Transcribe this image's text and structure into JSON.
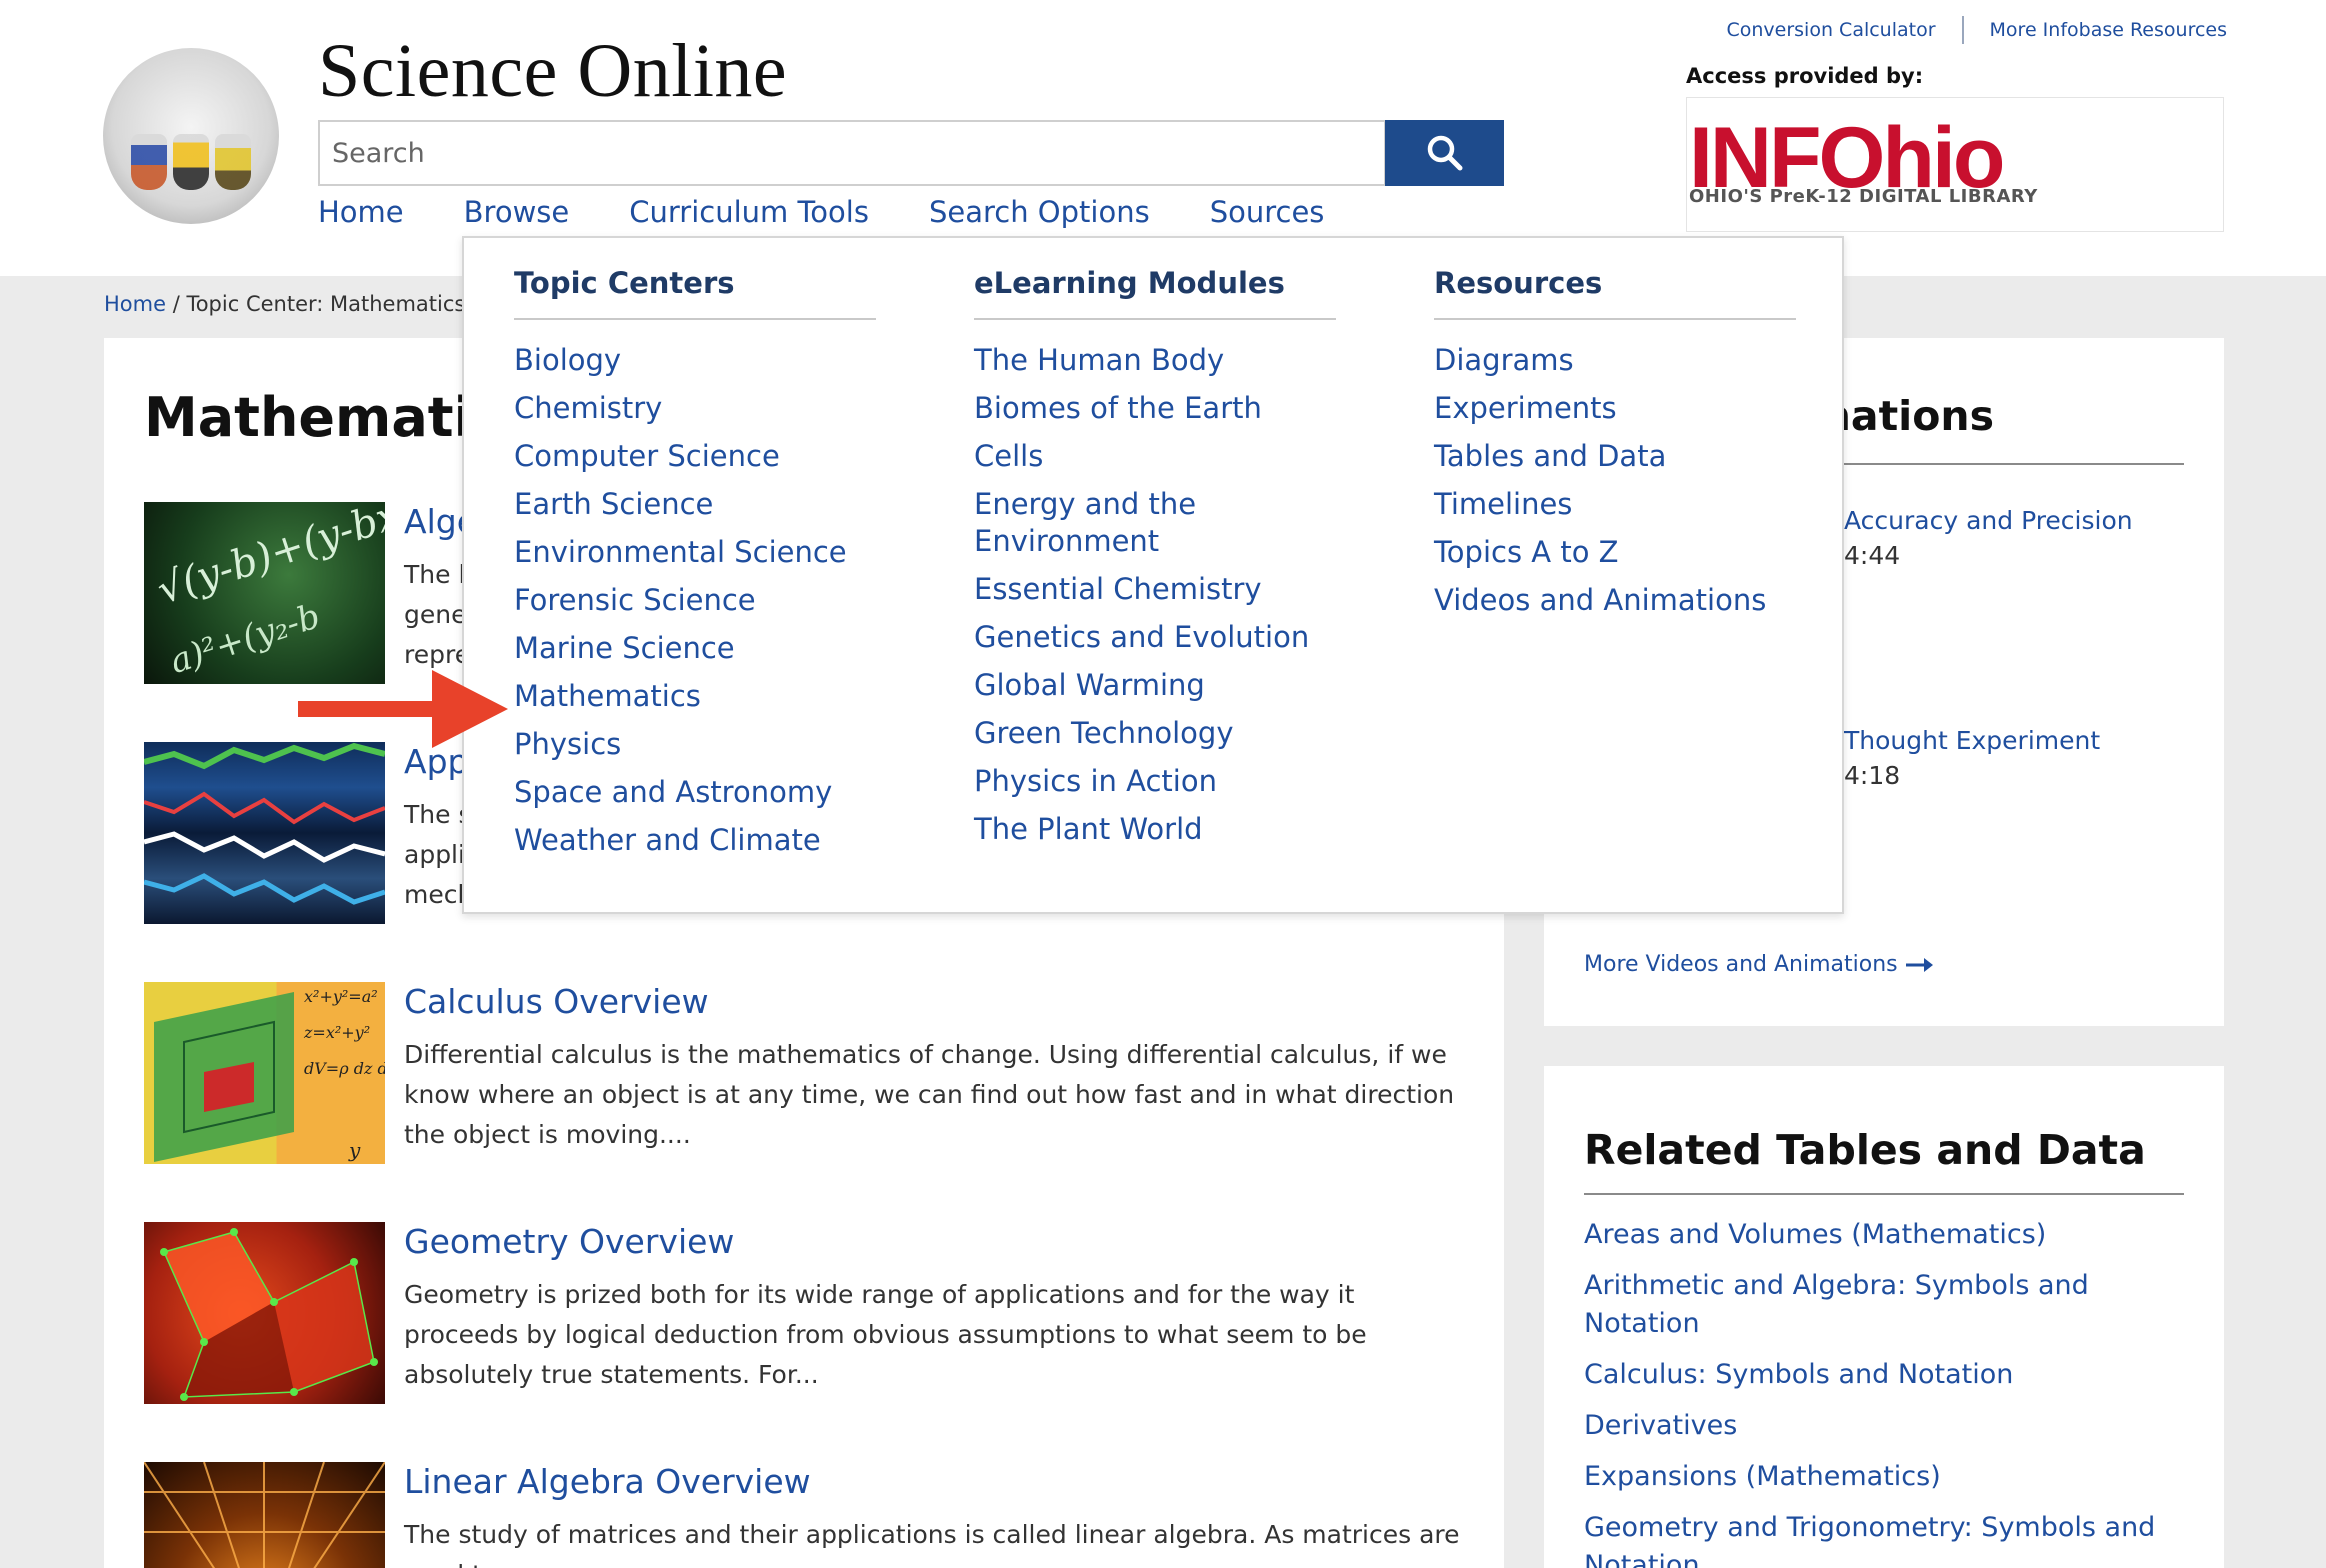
{
  "header": {
    "site_title": "Science Online",
    "search_placeholder": "Search",
    "nav": [
      "Home",
      "Browse",
      "Curriculum Tools",
      "Search Options",
      "Sources"
    ],
    "top_links": [
      "Conversion Calculator",
      "More Infobase Resources"
    ],
    "access_label": "Access provided by:",
    "provider_logo_text": "INFOhio",
    "provider_tagline": "OHIO'S PreK-12 DIGITAL LIBRARY"
  },
  "breadcrumb": {
    "home": "Home",
    "separator": " / ",
    "current": "Topic Center: Mathematics"
  },
  "main": {
    "title": "Mathematics",
    "topics": [
      {
        "title": "Alge",
        "desc": "The l\ngene\nrepre"
      },
      {
        "title": "App",
        "desc": "The s\nappli\nmech"
      },
      {
        "title": "Calculus Overview",
        "desc": "Differential calculus is the mathematics of change. Using differential calculus, if we know where an object is at any time, we can find out how fast and in what direction the object is moving...."
      },
      {
        "title": "Geometry Overview",
        "desc": "Geometry is prized both for its wide range of applications and for the way it proceeds by logical deduction from obvious assumptions to what seem to be absolutely true statements. For..."
      },
      {
        "title": "Linear Algebra Overview",
        "desc": "The study of matrices and their applications is called linear algebra. As matrices are used to"
      }
    ]
  },
  "videos": {
    "heading": "imations",
    "items": [
      {
        "title": "Accuracy and Precision",
        "time": "4:44"
      },
      {
        "title": "Thought Experiment",
        "time": "4:18"
      }
    ],
    "more_link": "More Videos and Animations"
  },
  "tables": {
    "heading": "Related Tables and Data",
    "items": [
      "Areas and Volumes (Mathematics)",
      "Arithmetic and Algebra: Symbols and Notation",
      "Calculus: Symbols and Notation",
      "Derivatives",
      "Expansions (Mathematics)",
      "Geometry and Trigonometry: Symbols and Notation"
    ]
  },
  "dropdown": {
    "topic_centers": {
      "heading": "Topic Centers",
      "items": [
        "Biology",
        "Chemistry",
        "Computer Science",
        "Earth Science",
        "Environmental Science",
        "Forensic Science",
        "Marine Science",
        "Mathematics",
        "Physics",
        "Space and Astronomy",
        "Weather and Climate"
      ]
    },
    "elearning": {
      "heading": "eLearning Modules",
      "items": [
        "The Human Body",
        "Biomes of the Earth",
        "Cells",
        "Energy and the Environment",
        "Essential Chemistry",
        "Genetics and Evolution",
        "Global Warming",
        "Green Technology",
        "Physics in Action",
        "The Plant World"
      ]
    },
    "resources": {
      "heading": "Resources",
      "items": [
        "Diagrams",
        "Experiments",
        "Tables and Data",
        "Timelines",
        "Topics A to Z",
        "Videos and Animations"
      ]
    }
  },
  "colors": {
    "link": "#1f4e9e",
    "search_button": "#1e4b8c",
    "annotation_arrow": "#e8422a",
    "provider_logo": "#c8102e"
  },
  "icons": {
    "search": "magnifier-icon",
    "more_arrow": "arrow-right-icon",
    "annotation": "red-arrow-icon"
  }
}
